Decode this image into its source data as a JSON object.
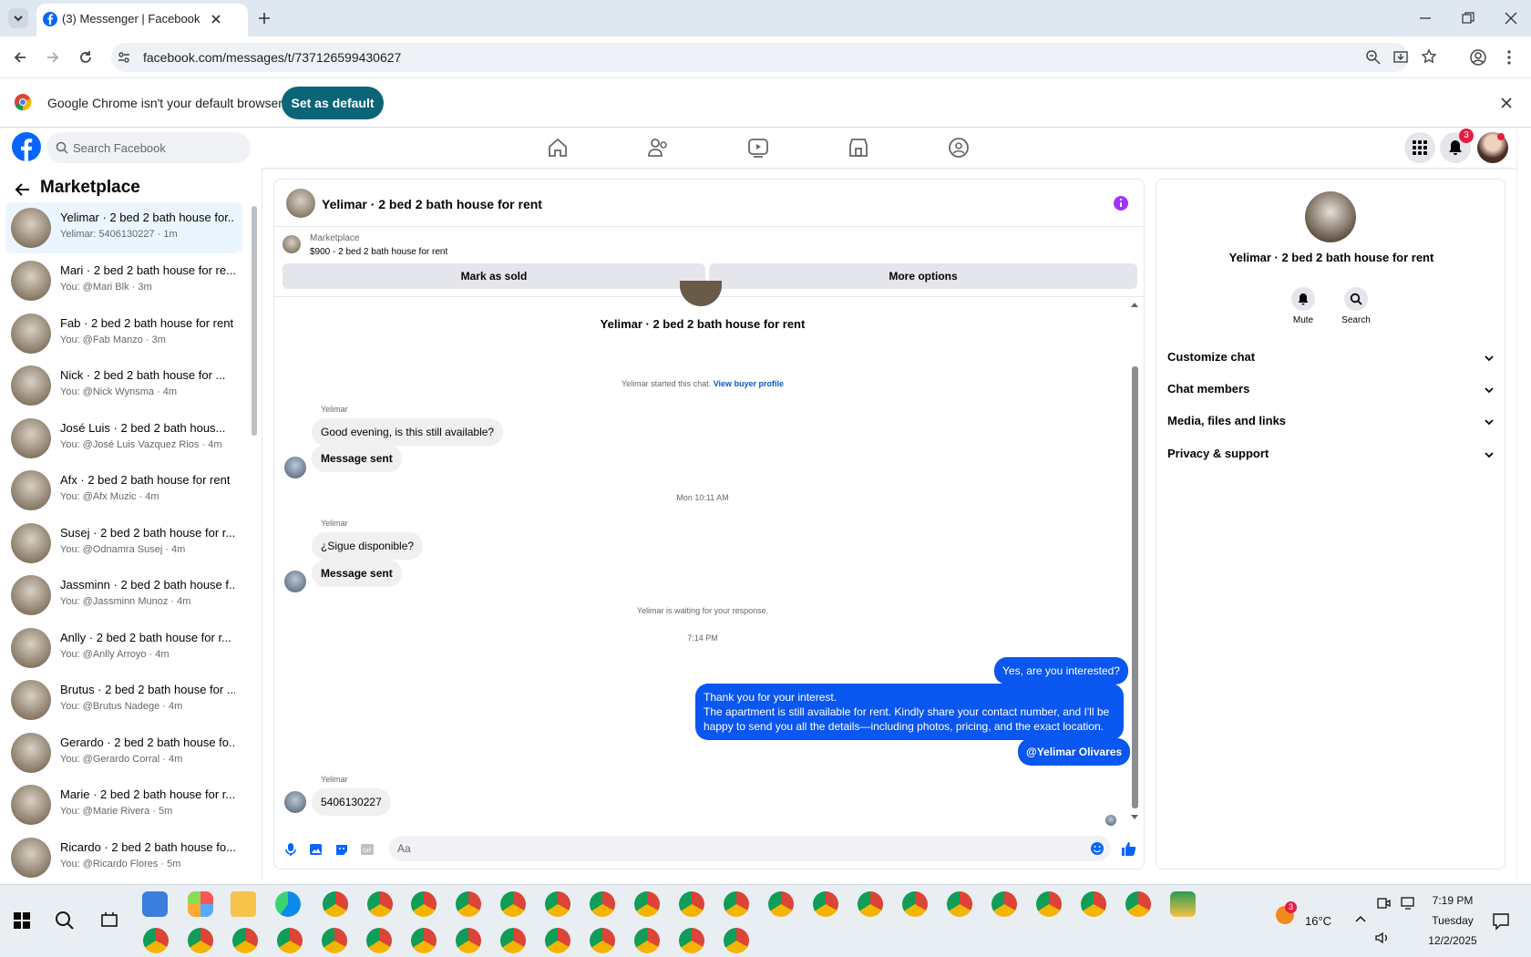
{
  "browser": {
    "tab_title": "(3) Messenger | Facebook",
    "url": "facebook.com/messages/t/737126599430627",
    "infobar_text": "Google Chrome isn't your default browser",
    "infobar_button": "Set as default"
  },
  "fb": {
    "search_placeholder": "Search Facebook",
    "notification_count": "3"
  },
  "left": {
    "title": "Marketplace",
    "items": [
      {
        "title": "Yelimar · 2 bed 2 bath house for...",
        "sub": "Yelimar: 5406130227 · 1m"
      },
      {
        "title": "Mari · 2 bed 2 bath house for re...",
        "sub": "You: @Mari Blk · 3m"
      },
      {
        "title": "Fab · 2 bed 2 bath house for rent",
        "sub": "You: @Fab Manzo · 3m"
      },
      {
        "title": "Nick · 2 bed 2 bath house for ...",
        "sub": "You: @Nick Wynsma · 4m"
      },
      {
        "title": "José Luis · 2 bed 2 bath hous...",
        "sub": "You: @José Luis Vazquez Rios · 4m"
      },
      {
        "title": "Afx · 2 bed 2 bath house for rent",
        "sub": "You: @Afx Muzic · 4m"
      },
      {
        "title": "Susej · 2 bed 2 bath house for r...",
        "sub": "You: @Odnamra Susej · 4m"
      },
      {
        "title": "Jassminn · 2 bed 2 bath house f...",
        "sub": "You: @Jassminn Munoz · 4m"
      },
      {
        "title": "Anlly · 2 bed 2 bath house for r...",
        "sub": "You: @Anlly Arroyo · 4m"
      },
      {
        "title": "Brutus · 2 bed 2 bath house for ...",
        "sub": "You: @Brutus Nadege · 4m"
      },
      {
        "title": "Gerardo · 2 bed 2 bath house fo...",
        "sub": "You: @Gerardo Corral · 4m"
      },
      {
        "title": "Marie · 2 bed 2 bath house for r...",
        "sub": "You: @Marie Rivera · 5m"
      },
      {
        "title": "Ricardo · 2 bed 2 bath house fo...",
        "sub": "You: @Ricardo Flores · 5m"
      }
    ]
  },
  "chat": {
    "header_title": "Yelimar · 2 bed 2 bath house for rent",
    "listing_source": "Marketplace",
    "listing_text": "$900 - 2 bed 2 bath house for rent",
    "mark_sold": "Mark as sold",
    "more_options": "More options",
    "profile_name": "Yelimar · 2 bed 2 bath house for rent",
    "started_text": "Yelimar started this chat.",
    "buyer_profile_link": "View buyer profile",
    "sender1": "Yelimar",
    "msg1": "Good evening, is this still available?",
    "msg_sent1": "Message sent",
    "time1": "Mon 10:11 AM",
    "sender2": "Yelimar",
    "msg2": "¿Sigue disponible?",
    "msg_sent2": "Message sent",
    "waiting": "Yelimar is waiting for your response.",
    "time2": "7:14 PM",
    "out1": "Yes, are you interested?",
    "out2_l1": "Thank you for your interest.",
    "out2_l2": "The apartment is still available for rent. Kindly share your contact number, and I'll be",
    "out2_l3": "happy to send you all the details—including photos, pricing, and the exact location.",
    "out3": "@Yelimar Olivares",
    "sender3": "Yelimar",
    "msg3": "5406130227",
    "composer_placeholder": "Aa"
  },
  "right": {
    "name": "Yelimar · 2 bed 2 bath house for rent",
    "mute": "Mute",
    "search": "Search",
    "sections": [
      "Customize chat",
      "Chat members",
      "Media, files and links",
      "Privacy & support"
    ]
  },
  "taskbar": {
    "temp": "16°C",
    "weather_badge": "3",
    "time": "7:19 PM",
    "day": "Tuesday",
    "date": "12/2/2025"
  },
  "colors": {
    "fb_blue": "#0866ff",
    "bubble_out": "#0a56f0",
    "set_default": "#0b6577"
  }
}
